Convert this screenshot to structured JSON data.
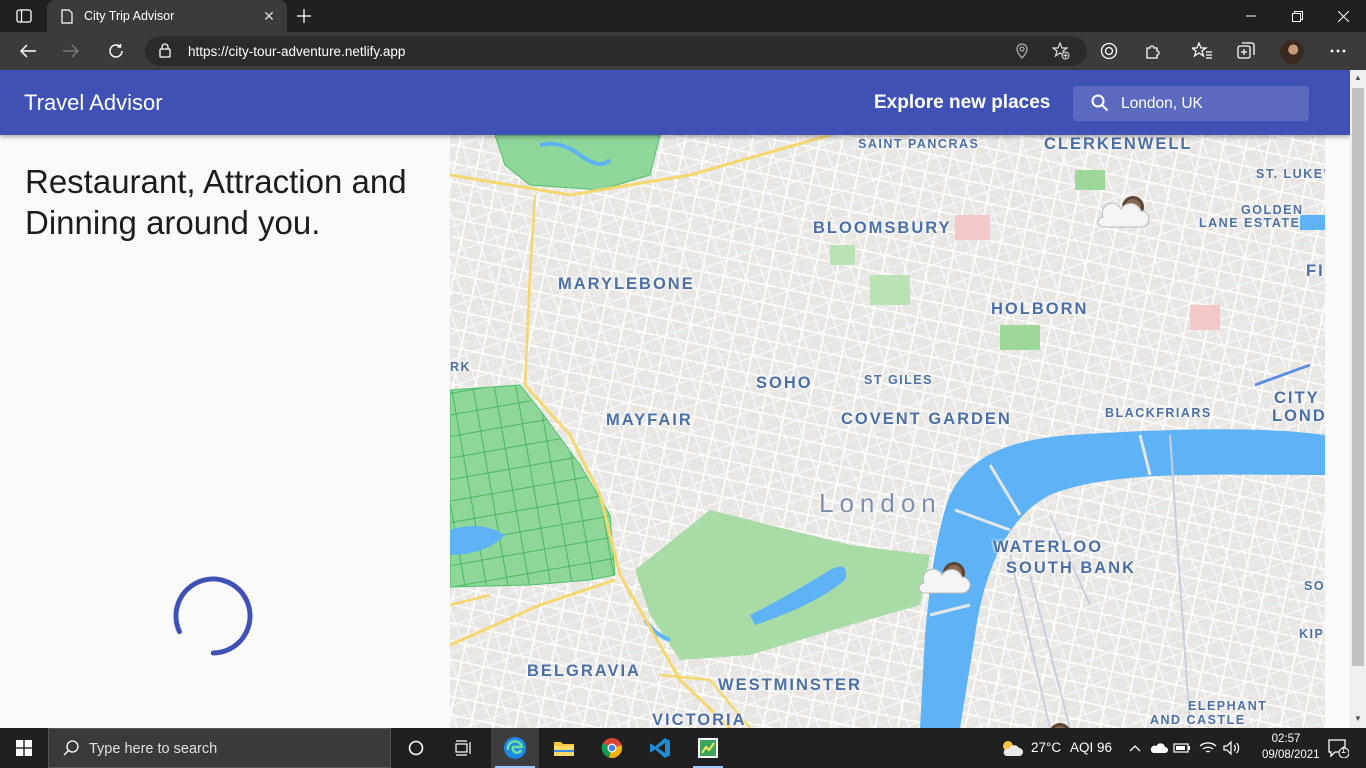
{
  "browser": {
    "tab_title": "City Trip Advisor",
    "url": "https://city-tour-adventure.netlify.app"
  },
  "app": {
    "brand": "Travel Advisor",
    "explore_label": "Explore new places",
    "search_value": "London, UK",
    "heading": "Restaurant, Attraction and Dinning around you."
  },
  "map": {
    "labels": {
      "saint_pancras": "SAINT PANCRAS",
      "clerkenwell": "CLERKENWELL",
      "st_lukes": "ST. LUKE'",
      "golden_lane_1": "GOLDEN",
      "golden_lane_2": "LANE ESTATE",
      "fi": "FI",
      "bloomsbury": "BLOOMSBURY",
      "marylebone": "MARYLEBONE",
      "holborn": "HOLBORN",
      "rk": "RK",
      "soho": "SOHO",
      "st_giles": "ST GILES",
      "mayfair": "MAYFAIR",
      "covent_garden": "COVENT GARDEN",
      "blackfriars": "BLACKFRIARS",
      "city_1": "CITY",
      "city_2": "LOND",
      "london": "London",
      "waterloo": "WATERLOO",
      "south_bank": "SOUTH BANK",
      "so": "SO",
      "kip": "KIP",
      "belgravia": "BELGRAVIA",
      "westminster": "WESTMINSTER",
      "victoria": "VICTORIA",
      "elephant_1": "ELEPHANT",
      "elephant_2": "AND CASTLE"
    },
    "colors": {
      "land": "#e9e6e2",
      "park": "#8ed69a",
      "water": "#5db3f5",
      "road": "#ffffff",
      "major_road": "#f5d76e"
    }
  },
  "taskbar": {
    "search_placeholder": "Type here to search",
    "weather": "27°C",
    "aqi": "AQI 96",
    "time": "02:57",
    "date": "09/08/2021",
    "notification_count": "1"
  }
}
